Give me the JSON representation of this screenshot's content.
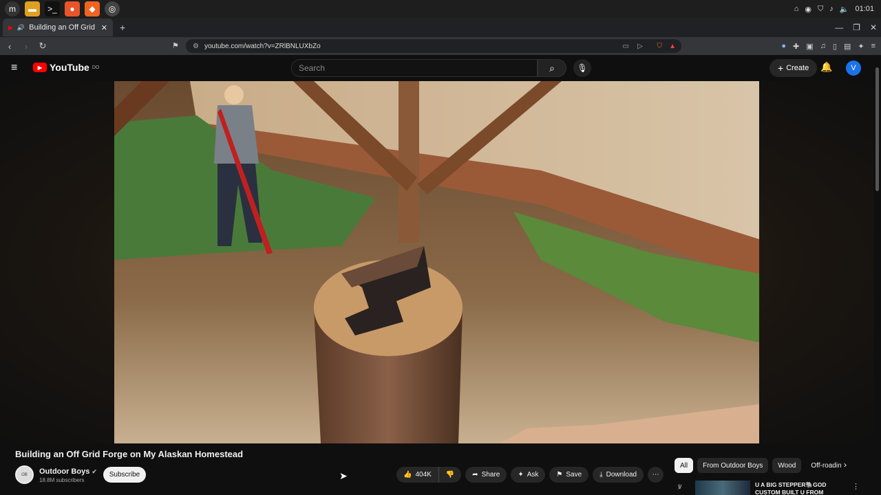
{
  "taskbar": {
    "apps": [
      "mint-menu",
      "files",
      "terminal",
      "firefox",
      "brave",
      "other"
    ],
    "clock": "01:01"
  },
  "browser": {
    "tab_title": "Building an Off Grid Forge",
    "url": "youtube.com/watch?v=ZRlBNLUXbZo"
  },
  "youtube": {
    "logo_text": "YouTube",
    "logo_sup": "DO",
    "search_placeholder": "Search",
    "create_label": "Create",
    "avatar_letter": "V"
  },
  "video": {
    "title": "Building an Off Grid Forge on My Alaskan Homestead",
    "channel": "Outdoor Boys",
    "subscribers": "18.8M subscribers",
    "subscribe_label": "Subscribe",
    "likes": "404K",
    "share_label": "Share",
    "ask_label": "Ask",
    "save_label": "Save",
    "download_label": "Download"
  },
  "chips": [
    "All",
    "From Outdoor Boys",
    "Wood",
    "Off-roadin"
  ],
  "recommendation": {
    "title": "U A BIG STEPPER🐘GOD CUSTOM BUILT U FROM",
    "channel_glyph": "℣"
  },
  "colors": {
    "accent_red": "#ff0000",
    "avatar_blue": "#1a73e8",
    "bg": "#0f0f0f"
  }
}
